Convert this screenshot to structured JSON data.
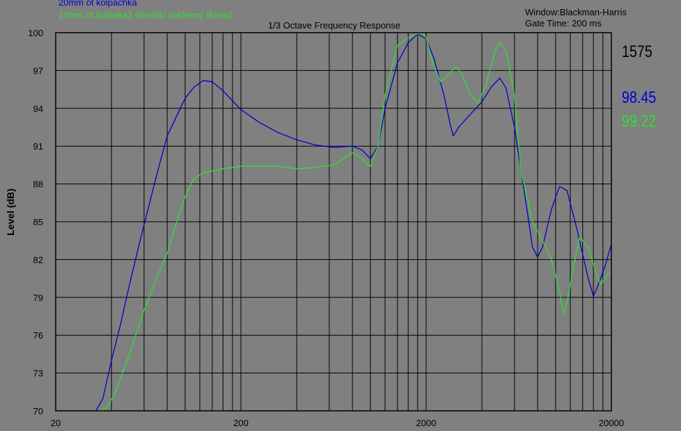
{
  "chart_data": {
    "type": "line",
    "title": "1/3 Octave Frequency Response",
    "ylabel": "Level (dB)",
    "xlabel": "",
    "xscale": "log",
    "xlim": [
      20,
      20000
    ],
    "ylim": [
      70,
      100
    ],
    "x_ticks": [
      {
        "value": 20,
        "label": "20"
      },
      {
        "value": 200,
        "label": "200"
      },
      {
        "value": 2000,
        "label": "2000"
      },
      {
        "value": 20000,
        "label": "20000"
      }
    ],
    "y_ticks": [
      {
        "value": 70,
        "label": "70"
      },
      {
        "value": 73,
        "label": "73"
      },
      {
        "value": 76,
        "label": "76"
      },
      {
        "value": 79,
        "label": "79"
      },
      {
        "value": 82,
        "label": "82"
      },
      {
        "value": 85,
        "label": "85"
      },
      {
        "value": 88,
        "label": "88"
      },
      {
        "value": 91,
        "label": "91"
      },
      {
        "value": 94,
        "label": "94"
      },
      {
        "value": 97,
        "label": "97"
      },
      {
        "value": 100,
        "label": "100"
      }
    ],
    "grid": true,
    "background_color": "#808080",
    "grid_color": "#000000",
    "series": [
      {
        "name": "20mm ot kolpachka",
        "color": "#0000d0",
        "points": [
          [
            20,
            70
          ],
          [
            33,
            70
          ],
          [
            36,
            71
          ],
          [
            40,
            74
          ],
          [
            45,
            77
          ],
          [
            50,
            80
          ],
          [
            56,
            83
          ],
          [
            63,
            86
          ],
          [
            71,
            89
          ],
          [
            80,
            91.8
          ],
          [
            90,
            93.4
          ],
          [
            100,
            94.8
          ],
          [
            112,
            95.7
          ],
          [
            125,
            96.2
          ],
          [
            140,
            96.1
          ],
          [
            160,
            95.4
          ],
          [
            180,
            94.6
          ],
          [
            200,
            93.9
          ],
          [
            250,
            92.9
          ],
          [
            315,
            92.1
          ],
          [
            400,
            91.5
          ],
          [
            500,
            91.1
          ],
          [
            630,
            90.9
          ],
          [
            800,
            91.0
          ],
          [
            900,
            90.7
          ],
          [
            1000,
            90.0
          ],
          [
            1100,
            91.0
          ],
          [
            1200,
            94.0
          ],
          [
            1400,
            97.6
          ],
          [
            1600,
            99.2
          ],
          [
            1800,
            99.9
          ],
          [
            2000,
            99.5
          ],
          [
            2200,
            98.0
          ],
          [
            2500,
            95.0
          ],
          [
            2700,
            92.7
          ],
          [
            2800,
            91.8
          ],
          [
            3000,
            92.5
          ],
          [
            3500,
            93.6
          ],
          [
            4000,
            94.5
          ],
          [
            4500,
            95.7
          ],
          [
            5000,
            96.4
          ],
          [
            5400,
            95.6
          ],
          [
            6000,
            92.5
          ],
          [
            7000,
            86.0
          ],
          [
            7500,
            83.0
          ],
          [
            8000,
            82.2
          ],
          [
            8500,
            83.0
          ],
          [
            9500,
            86.0
          ],
          [
            10500,
            87.8
          ],
          [
            11500,
            87.5
          ],
          [
            13000,
            84.5
          ],
          [
            15000,
            80.5
          ],
          [
            16000,
            79.1
          ],
          [
            17000,
            80.0
          ],
          [
            18500,
            81.5
          ],
          [
            20000,
            83.2
          ]
        ]
      },
      {
        "name": "10mm ot kolpaka2 okoshki zakleeny tkany2",
        "color": "#30e030",
        "points": [
          [
            20,
            70
          ],
          [
            35,
            70
          ],
          [
            38,
            70.3
          ],
          [
            42,
            71.5
          ],
          [
            50,
            74.5
          ],
          [
            60,
            78
          ],
          [
            70,
            80.5
          ],
          [
            80,
            82.5
          ],
          [
            90,
            85
          ],
          [
            100,
            87
          ],
          [
            110,
            88.3
          ],
          [
            125,
            88.9
          ],
          [
            160,
            89.2
          ],
          [
            200,
            89.4
          ],
          [
            250,
            89.4
          ],
          [
            315,
            89.4
          ],
          [
            400,
            89.2
          ],
          [
            500,
            89.3
          ],
          [
            630,
            89.5
          ],
          [
            700,
            89.9
          ],
          [
            800,
            90.5
          ],
          [
            900,
            90.0
          ],
          [
            1000,
            89.4
          ],
          [
            1100,
            91.0
          ],
          [
            1200,
            95.0
          ],
          [
            1400,
            99.0
          ],
          [
            1600,
            99.6
          ],
          [
            1800,
            99.9
          ],
          [
            1900,
            100
          ],
          [
            2000,
            99.6
          ],
          [
            2200,
            97.3
          ],
          [
            2400,
            96.1
          ],
          [
            2600,
            96.6
          ],
          [
            2900,
            97.3
          ],
          [
            3100,
            96.8
          ],
          [
            3500,
            95.0
          ],
          [
            3800,
            94.4
          ],
          [
            4200,
            95.8
          ],
          [
            4700,
            98.5
          ],
          [
            5000,
            99.2
          ],
          [
            5400,
            98.6
          ],
          [
            6000,
            95.0
          ],
          [
            6500,
            89.0
          ],
          [
            7000,
            87.0
          ],
          [
            7500,
            85.0
          ],
          [
            8500,
            83.5
          ],
          [
            9500,
            82.0
          ],
          [
            10500,
            79.5
          ],
          [
            11000,
            77.7
          ],
          [
            11500,
            78.5
          ],
          [
            12500,
            81.5
          ],
          [
            13500,
            83.8
          ],
          [
            15000,
            83.0
          ],
          [
            16500,
            81.0
          ],
          [
            17500,
            80.0
          ],
          [
            19000,
            80.8
          ],
          [
            20000,
            81.1
          ]
        ]
      }
    ],
    "annotations": {
      "window": "Window:Blackman-Harris",
      "gate": "Gate Time: 200 ms",
      "cursor_freq": "1575",
      "cursor_value_1": "98.45",
      "cursor_value_2": "99.22"
    }
  }
}
